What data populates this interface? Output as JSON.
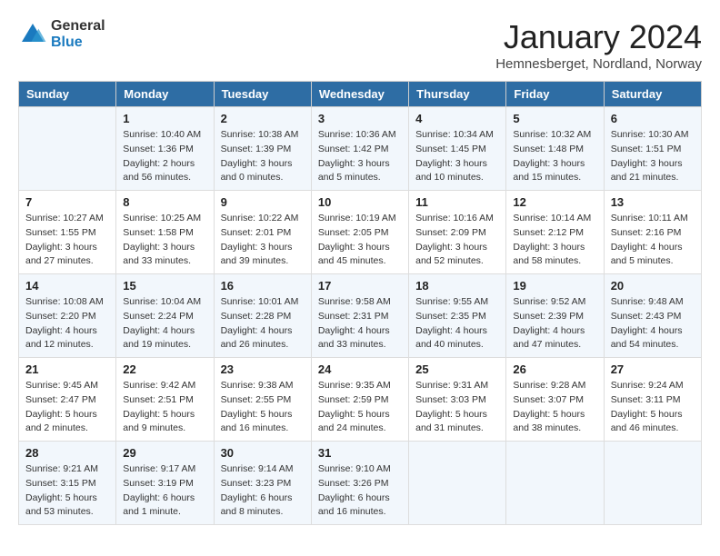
{
  "logo": {
    "text_general": "General",
    "text_blue": "Blue"
  },
  "title": "January 2024",
  "subtitle": "Hemnesberget, Nordland, Norway",
  "days_of_week": [
    "Sunday",
    "Monday",
    "Tuesday",
    "Wednesday",
    "Thursday",
    "Friday",
    "Saturday"
  ],
  "weeks": [
    [
      {
        "day": "",
        "sunrise": "",
        "sunset": "",
        "daylight": ""
      },
      {
        "day": "1",
        "sunrise": "Sunrise: 10:40 AM",
        "sunset": "Sunset: 1:36 PM",
        "daylight": "Daylight: 2 hours and 56 minutes."
      },
      {
        "day": "2",
        "sunrise": "Sunrise: 10:38 AM",
        "sunset": "Sunset: 1:39 PM",
        "daylight": "Daylight: 3 hours and 0 minutes."
      },
      {
        "day": "3",
        "sunrise": "Sunrise: 10:36 AM",
        "sunset": "Sunset: 1:42 PM",
        "daylight": "Daylight: 3 hours and 5 minutes."
      },
      {
        "day": "4",
        "sunrise": "Sunrise: 10:34 AM",
        "sunset": "Sunset: 1:45 PM",
        "daylight": "Daylight: 3 hours and 10 minutes."
      },
      {
        "day": "5",
        "sunrise": "Sunrise: 10:32 AM",
        "sunset": "Sunset: 1:48 PM",
        "daylight": "Daylight: 3 hours and 15 minutes."
      },
      {
        "day": "6",
        "sunrise": "Sunrise: 10:30 AM",
        "sunset": "Sunset: 1:51 PM",
        "daylight": "Daylight: 3 hours and 21 minutes."
      }
    ],
    [
      {
        "day": "7",
        "sunrise": "Sunrise: 10:27 AM",
        "sunset": "Sunset: 1:55 PM",
        "daylight": "Daylight: 3 hours and 27 minutes."
      },
      {
        "day": "8",
        "sunrise": "Sunrise: 10:25 AM",
        "sunset": "Sunset: 1:58 PM",
        "daylight": "Daylight: 3 hours and 33 minutes."
      },
      {
        "day": "9",
        "sunrise": "Sunrise: 10:22 AM",
        "sunset": "Sunset: 2:01 PM",
        "daylight": "Daylight: 3 hours and 39 minutes."
      },
      {
        "day": "10",
        "sunrise": "Sunrise: 10:19 AM",
        "sunset": "Sunset: 2:05 PM",
        "daylight": "Daylight: 3 hours and 45 minutes."
      },
      {
        "day": "11",
        "sunrise": "Sunrise: 10:16 AM",
        "sunset": "Sunset: 2:09 PM",
        "daylight": "Daylight: 3 hours and 52 minutes."
      },
      {
        "day": "12",
        "sunrise": "Sunrise: 10:14 AM",
        "sunset": "Sunset: 2:12 PM",
        "daylight": "Daylight: 3 hours and 58 minutes."
      },
      {
        "day": "13",
        "sunrise": "Sunrise: 10:11 AM",
        "sunset": "Sunset: 2:16 PM",
        "daylight": "Daylight: 4 hours and 5 minutes."
      }
    ],
    [
      {
        "day": "14",
        "sunrise": "Sunrise: 10:08 AM",
        "sunset": "Sunset: 2:20 PM",
        "daylight": "Daylight: 4 hours and 12 minutes."
      },
      {
        "day": "15",
        "sunrise": "Sunrise: 10:04 AM",
        "sunset": "Sunset: 2:24 PM",
        "daylight": "Daylight: 4 hours and 19 minutes."
      },
      {
        "day": "16",
        "sunrise": "Sunrise: 10:01 AM",
        "sunset": "Sunset: 2:28 PM",
        "daylight": "Daylight: 4 hours and 26 minutes."
      },
      {
        "day": "17",
        "sunrise": "Sunrise: 9:58 AM",
        "sunset": "Sunset: 2:31 PM",
        "daylight": "Daylight: 4 hours and 33 minutes."
      },
      {
        "day": "18",
        "sunrise": "Sunrise: 9:55 AM",
        "sunset": "Sunset: 2:35 PM",
        "daylight": "Daylight: 4 hours and 40 minutes."
      },
      {
        "day": "19",
        "sunrise": "Sunrise: 9:52 AM",
        "sunset": "Sunset: 2:39 PM",
        "daylight": "Daylight: 4 hours and 47 minutes."
      },
      {
        "day": "20",
        "sunrise": "Sunrise: 9:48 AM",
        "sunset": "Sunset: 2:43 PM",
        "daylight": "Daylight: 4 hours and 54 minutes."
      }
    ],
    [
      {
        "day": "21",
        "sunrise": "Sunrise: 9:45 AM",
        "sunset": "Sunset: 2:47 PM",
        "daylight": "Daylight: 5 hours and 2 minutes."
      },
      {
        "day": "22",
        "sunrise": "Sunrise: 9:42 AM",
        "sunset": "Sunset: 2:51 PM",
        "daylight": "Daylight: 5 hours and 9 minutes."
      },
      {
        "day": "23",
        "sunrise": "Sunrise: 9:38 AM",
        "sunset": "Sunset: 2:55 PM",
        "daylight": "Daylight: 5 hours and 16 minutes."
      },
      {
        "day": "24",
        "sunrise": "Sunrise: 9:35 AM",
        "sunset": "Sunset: 2:59 PM",
        "daylight": "Daylight: 5 hours and 24 minutes."
      },
      {
        "day": "25",
        "sunrise": "Sunrise: 9:31 AM",
        "sunset": "Sunset: 3:03 PM",
        "daylight": "Daylight: 5 hours and 31 minutes."
      },
      {
        "day": "26",
        "sunrise": "Sunrise: 9:28 AM",
        "sunset": "Sunset: 3:07 PM",
        "daylight": "Daylight: 5 hours and 38 minutes."
      },
      {
        "day": "27",
        "sunrise": "Sunrise: 9:24 AM",
        "sunset": "Sunset: 3:11 PM",
        "daylight": "Daylight: 5 hours and 46 minutes."
      }
    ],
    [
      {
        "day": "28",
        "sunrise": "Sunrise: 9:21 AM",
        "sunset": "Sunset: 3:15 PM",
        "daylight": "Daylight: 5 hours and 53 minutes."
      },
      {
        "day": "29",
        "sunrise": "Sunrise: 9:17 AM",
        "sunset": "Sunset: 3:19 PM",
        "daylight": "Daylight: 6 hours and 1 minute."
      },
      {
        "day": "30",
        "sunrise": "Sunrise: 9:14 AM",
        "sunset": "Sunset: 3:23 PM",
        "daylight": "Daylight: 6 hours and 8 minutes."
      },
      {
        "day": "31",
        "sunrise": "Sunrise: 9:10 AM",
        "sunset": "Sunset: 3:26 PM",
        "daylight": "Daylight: 6 hours and 16 minutes."
      },
      {
        "day": "",
        "sunrise": "",
        "sunset": "",
        "daylight": ""
      },
      {
        "day": "",
        "sunrise": "",
        "sunset": "",
        "daylight": ""
      },
      {
        "day": "",
        "sunrise": "",
        "sunset": "",
        "daylight": ""
      }
    ]
  ]
}
